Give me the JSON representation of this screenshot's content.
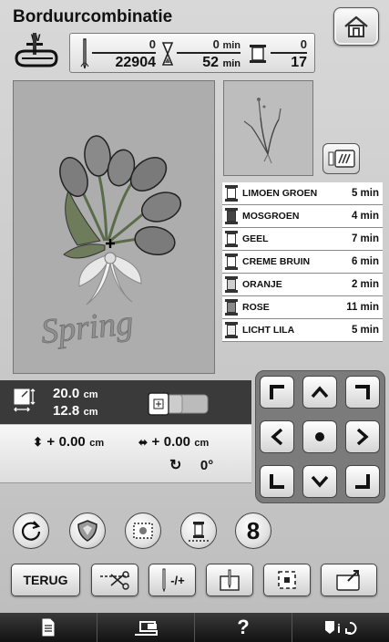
{
  "header": {
    "title": "Borduurcombinatie"
  },
  "info": {
    "stitches_done": "0",
    "stitches_total": "22904",
    "time_done": "0",
    "time_done_unit": "min",
    "time_total": "52",
    "time_total_unit": "min",
    "colors_done": "0",
    "colors_total": "17"
  },
  "preview": {
    "design_text": "Spring"
  },
  "threads": [
    {
      "name": "LIMOEN GROEN",
      "time": "5 min",
      "color": "#ffffff"
    },
    {
      "name": "MOSGROEN",
      "time": "4 min",
      "color": "#444444"
    },
    {
      "name": "GEEL",
      "time": "7 min",
      "color": "#ffffff"
    },
    {
      "name": "CREME BRUIN",
      "time": "6 min",
      "color": "#ffffff"
    },
    {
      "name": "ORANJE",
      "time": "2 min",
      "color": "#cfcfcf"
    },
    {
      "name": "ROSE",
      "time": "11 min",
      "color": "#8a8a8a"
    },
    {
      "name": "LICHT LILA",
      "time": "5 min",
      "color": "#eeeeee"
    }
  ],
  "size": {
    "height": "20.0",
    "height_unit": "cm",
    "width": "12.8",
    "width_unit": "cm"
  },
  "position": {
    "vertical_prefix": "+",
    "vertical": "0.00",
    "vertical_unit": "cm",
    "horizontal_prefix": "+",
    "horizontal": "0.00",
    "horizontal_unit": "cm",
    "rotation": "0°"
  },
  "buttons": {
    "back": "TERUG",
    "stitch_adjust": "-/+",
    "count": "8",
    "help": "?"
  },
  "icons": {
    "home": "home-icon",
    "thread_palette": "thread-palette-icon",
    "rotate": "rotate-icon",
    "shield": "shield-icon",
    "frame": "frame-icon",
    "spool": "spool-icon"
  }
}
